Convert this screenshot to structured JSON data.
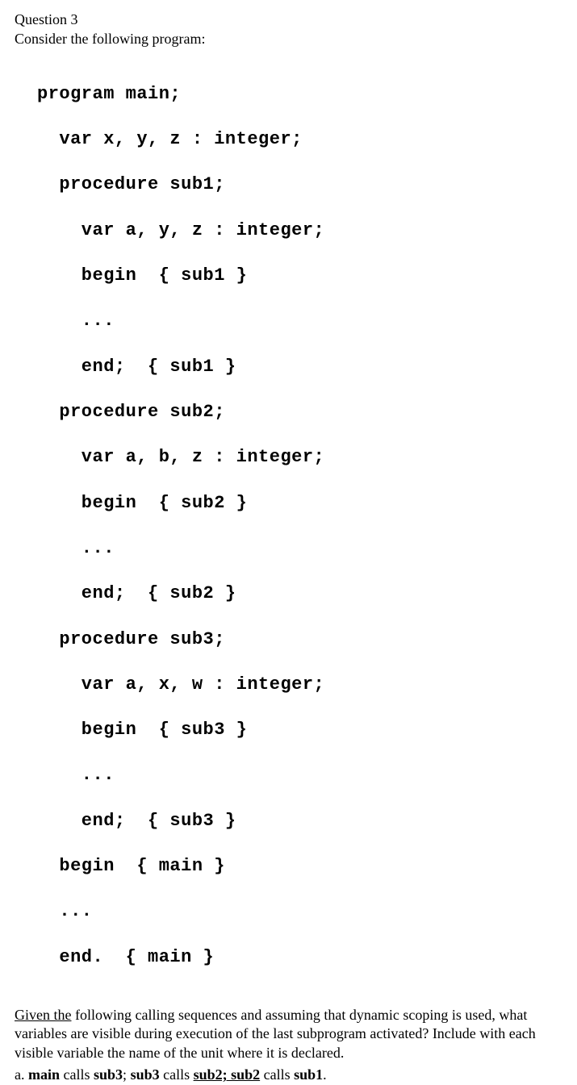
{
  "header": {
    "label": "Question 3",
    "prompt": "Consider the following program:"
  },
  "code": {
    "l0": "program main;",
    "l1": "  var x, y, z : integer;",
    "l2": "  procedure sub1;",
    "l3": "    var a, y, z : integer;",
    "l4": "    begin  { sub1 }",
    "l5": "    ...",
    "l6": "    end;  { sub1 }",
    "l7": "  procedure sub2;",
    "l8": "    var a, b, z : integer;",
    "l9": "    begin  { sub2 }",
    "l10": "    ...",
    "l11": "    end;  { sub2 }",
    "l12": "  procedure sub3;",
    "l13": "    var a, x, w : integer;",
    "l14": "    begin  { sub3 }",
    "l15": "    ...",
    "l16": "    end;  { sub3 }",
    "l17": "  begin  { main }",
    "l18": "  ...",
    "l19": "  end.  { main }"
  },
  "footer": {
    "given_u": "Given  the",
    "line1_rest": " following calling sequences and assuming that dynamic scoping is used, what",
    "line2": "variables are visible during execution of the last subprogram activated? Include with each",
    "line3": "visible variable the name of the unit where it is declared.",
    "item_a_label": "a.   ",
    "item_a_p1": "main",
    "item_a_p2": " calls ",
    "item_a_p3": "sub3",
    "item_a_p4": "; ",
    "item_a_p5": "sub3",
    "item_a_p6": " calls ",
    "item_a_p7": "sub2;  sub2",
    "item_a_p8": " calls ",
    "item_a_p9": "sub1",
    "item_a_p10": "."
  }
}
